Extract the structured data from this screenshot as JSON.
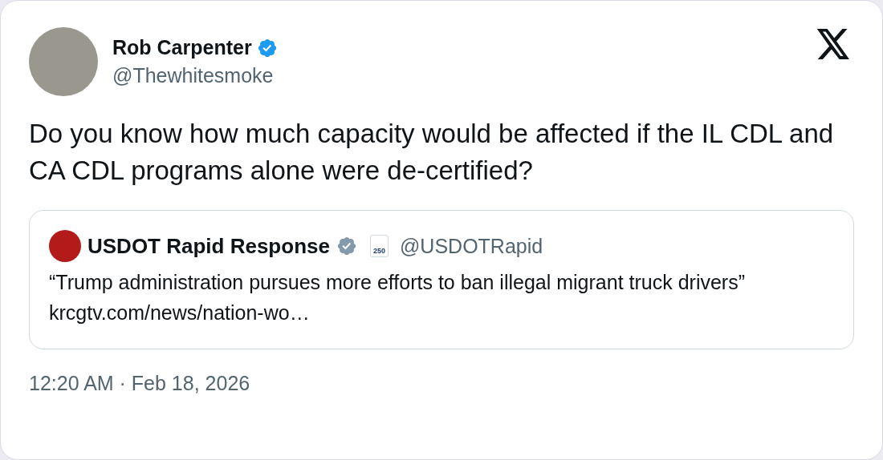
{
  "author": {
    "name": "Rob Carpenter",
    "verified": true,
    "handle": "@Thewhitesmoke"
  },
  "text": "Do you know how much capacity would be affected if the IL CDL and CA CDL programs alone were de-certified?",
  "quote": {
    "name": "USDOT Rapid Response",
    "verified": true,
    "badge": "250",
    "handle": "@USDOTRapid",
    "text": "“Trump administration pursues more efforts to ban illegal migrant truck drivers”",
    "link": "krcgtv.com/news/nation-wo…"
  },
  "timestamp": "12:20 AM · Feb 18, 2026"
}
